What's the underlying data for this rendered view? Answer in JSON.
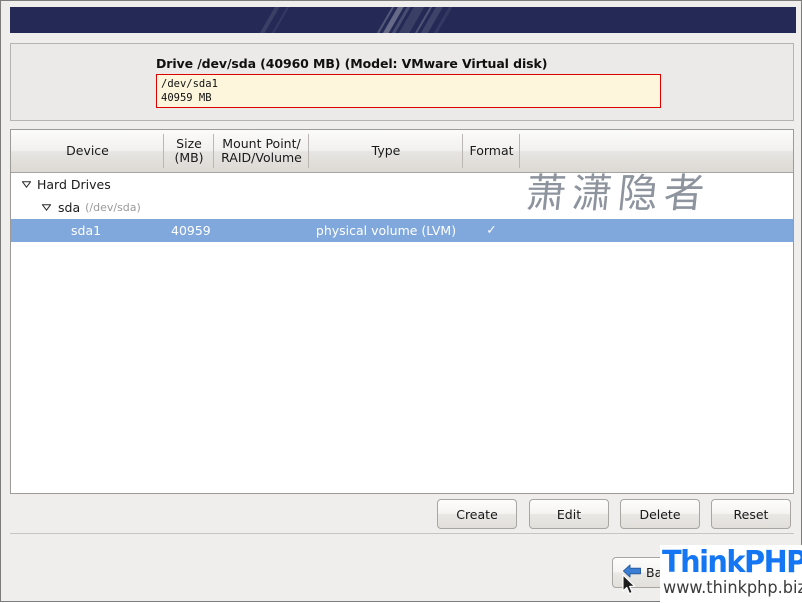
{
  "window": {
    "banner_color": "#242a55",
    "background_color": "#efeeec"
  },
  "drive_panel": {
    "title": "Drive /dev/sda (40960 MB) (Model: VMware Virtual disk)",
    "bar_border_color": "#dd0000",
    "bar_fill_color": "#fdf6dd",
    "segment": {
      "device": "/dev/sda1",
      "size": "40959 MB"
    }
  },
  "tree": {
    "columns": [
      {
        "id": "device",
        "label": "Device"
      },
      {
        "id": "size",
        "label_line1": "Size",
        "label_line2": "(MB)"
      },
      {
        "id": "mount",
        "label_line1": "Mount Point/",
        "label_line2": "RAID/Volume"
      },
      {
        "id": "type",
        "label": "Type"
      },
      {
        "id": "format",
        "label": "Format"
      }
    ],
    "rows": [
      {
        "name": "Hard Drives",
        "detail": "",
        "size": "",
        "mount": "",
        "type": "",
        "format": "",
        "selected": false,
        "expanded": true
      },
      {
        "name": "sda",
        "detail": "(/dev/sda)",
        "size": "",
        "mount": "",
        "type": "",
        "format": "",
        "selected": false,
        "expanded": true
      },
      {
        "name": "sda1",
        "detail": "",
        "size": "40959",
        "mount": "",
        "type": "physical volume (LVM)",
        "format": "✓",
        "selected": true,
        "expanded": null
      }
    ],
    "selection_color": "#81a8dc"
  },
  "watermark": {
    "text": "萧潇隐者"
  },
  "actions": {
    "create": "Create",
    "edit": "Edit",
    "delete": "Delete",
    "reset": "Reset"
  },
  "navigation": {
    "back": "Back"
  },
  "branding": {
    "name": "ThinkPHP",
    "url": "www.thinkphp.biz",
    "name_color": "#1476f2"
  }
}
